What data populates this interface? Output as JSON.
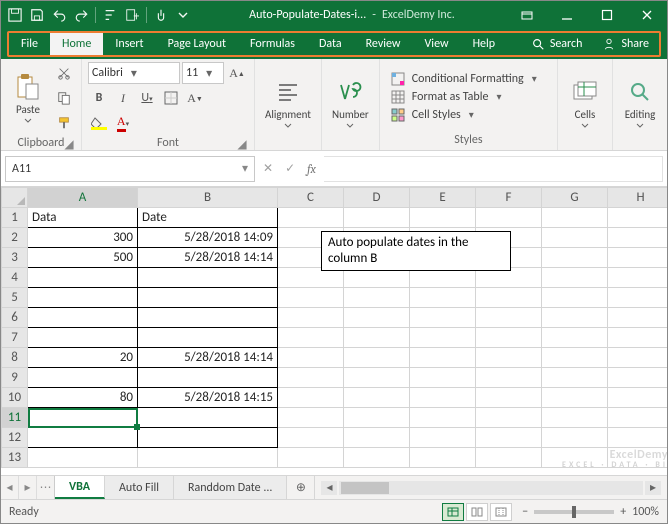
{
  "title": {
    "filename": "Auto-Populate-Dates-i...",
    "company": "ExcelDemy Inc."
  },
  "menu": {
    "file": "File",
    "home": "Home",
    "insert": "Insert",
    "pagelayout": "Page Layout",
    "formulas": "Formulas",
    "data": "Data",
    "review": "Review",
    "view": "View",
    "help": "Help",
    "search": "Search",
    "share": "Share"
  },
  "ribbon": {
    "clipboard": {
      "paste": "Paste",
      "group": "Clipboard"
    },
    "font": {
      "group": "Font",
      "name": "Calibri",
      "size": "11"
    },
    "alignment": {
      "label": "Alignment"
    },
    "number": {
      "label": "Number"
    },
    "styles": {
      "group": "Styles",
      "conditional": "Conditional Formatting",
      "table": "Format as Table",
      "cell": "Cell Styles"
    },
    "cells": {
      "label": "Cells"
    },
    "editing": {
      "label": "Editing"
    }
  },
  "namebox": "A11",
  "columns": [
    "A",
    "B",
    "C",
    "D",
    "E",
    "F",
    "G",
    "H"
  ],
  "rows": [
    "1",
    "2",
    "3",
    "4",
    "5",
    "6",
    "7",
    "8",
    "9",
    "10",
    "11",
    "12",
    "13"
  ],
  "sheet": {
    "A1": "Data",
    "B1": "Date",
    "A2": "300",
    "B2": "5/28/2018 14:09",
    "A3": "500",
    "B3": "5/28/2018 14:14",
    "A8": "20",
    "B8": "5/28/2018 14:14",
    "A10": "80",
    "B10": "5/28/2018 14:15"
  },
  "textbox": "Auto populate dates in the column B",
  "tabs": {
    "a": "VBA",
    "b": "Auto Fill",
    "c": "Randdom Date",
    "ell": "..."
  },
  "status": {
    "ready": "Ready",
    "zoom": "100%"
  },
  "watermark": {
    "main": "ExcelDemy",
    "sub": "EXCEL · DATA · BI"
  }
}
